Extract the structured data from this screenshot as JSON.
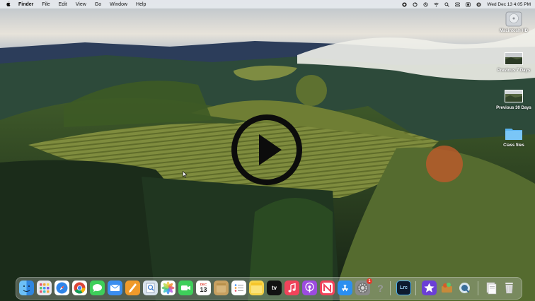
{
  "menubar": {
    "app_name": "Finder",
    "menus": [
      "File",
      "Edit",
      "View",
      "Go",
      "Window",
      "Help"
    ],
    "clock": "Wed Dec 13  4:05 PM",
    "status_icons": [
      "record-icon",
      "sync-icon",
      "time-machine-icon",
      "wifi-icon",
      "search-icon",
      "control-center-icon",
      "display-icon",
      "siri-icon"
    ]
  },
  "desktop": {
    "icons": [
      {
        "label": "Macintosh HD",
        "icon": "hard-drive-icon"
      },
      {
        "label": "Previous 7 Days",
        "icon": "image-thumbnail-icon"
      },
      {
        "label": "Previous 30 Days",
        "icon": "image-thumbnail-icon"
      },
      {
        "label": "Class files",
        "icon": "folder-icon"
      }
    ]
  },
  "video": {
    "control": "play-button-icon"
  },
  "dock": {
    "apps": [
      {
        "name": "finder-icon",
        "color": "#4aa3f0"
      },
      {
        "name": "launchpad-icon",
        "color": "#8a8ad8"
      },
      {
        "name": "safari-icon",
        "color": "#2f7fe0"
      },
      {
        "name": "chrome-icon",
        "color": "#ffffff"
      },
      {
        "name": "messages-icon",
        "color": "#3ecf5a"
      },
      {
        "name": "mail-icon",
        "color": "#3a8ef0"
      },
      {
        "name": "pages-icon",
        "color": "#f09a2a"
      },
      {
        "name": "preview-icon",
        "color": "#d9e3ee"
      },
      {
        "name": "photos-icon",
        "color": "#ffffff"
      },
      {
        "name": "facetime-icon",
        "color": "#3ecf5a"
      },
      {
        "name": "calendar-icon",
        "color": "#ffffff",
        "month": "DEC",
        "day": "13"
      },
      {
        "name": "notes-icon",
        "color": "#c8a060"
      },
      {
        "name": "reminders-icon",
        "color": "#ffffff"
      },
      {
        "name": "stickies-icon",
        "color": "#f7d348"
      },
      {
        "name": "apple-tv-icon",
        "color": "#111111",
        "text": "tv"
      },
      {
        "name": "music-icon",
        "color": "#f0435a"
      },
      {
        "name": "podcasts-icon",
        "color": "#9c4be0"
      },
      {
        "name": "news-icon",
        "color": "#f0435a"
      },
      {
        "name": "app-store-icon",
        "color": "#2b8ff0"
      },
      {
        "name": "system-settings-icon",
        "color": "#8a8a8a",
        "badge": "1"
      },
      {
        "name": "help-icon",
        "color": "transparent",
        "text": "?"
      },
      {
        "name": "lightroom-classic-icon",
        "color": "#0d1b2e",
        "text": "Lrc"
      },
      {
        "name": "imovie-icon",
        "color": "#6b3fd6"
      },
      {
        "name": "archive-utility-icon",
        "color": "#c88a3a"
      },
      {
        "name": "quicktime-icon",
        "color": "#4a6e8a"
      },
      {
        "name": "documents-folder-icon",
        "color": "#e8e8e8"
      },
      {
        "name": "trash-icon",
        "color": "#cfcfcf"
      }
    ]
  }
}
